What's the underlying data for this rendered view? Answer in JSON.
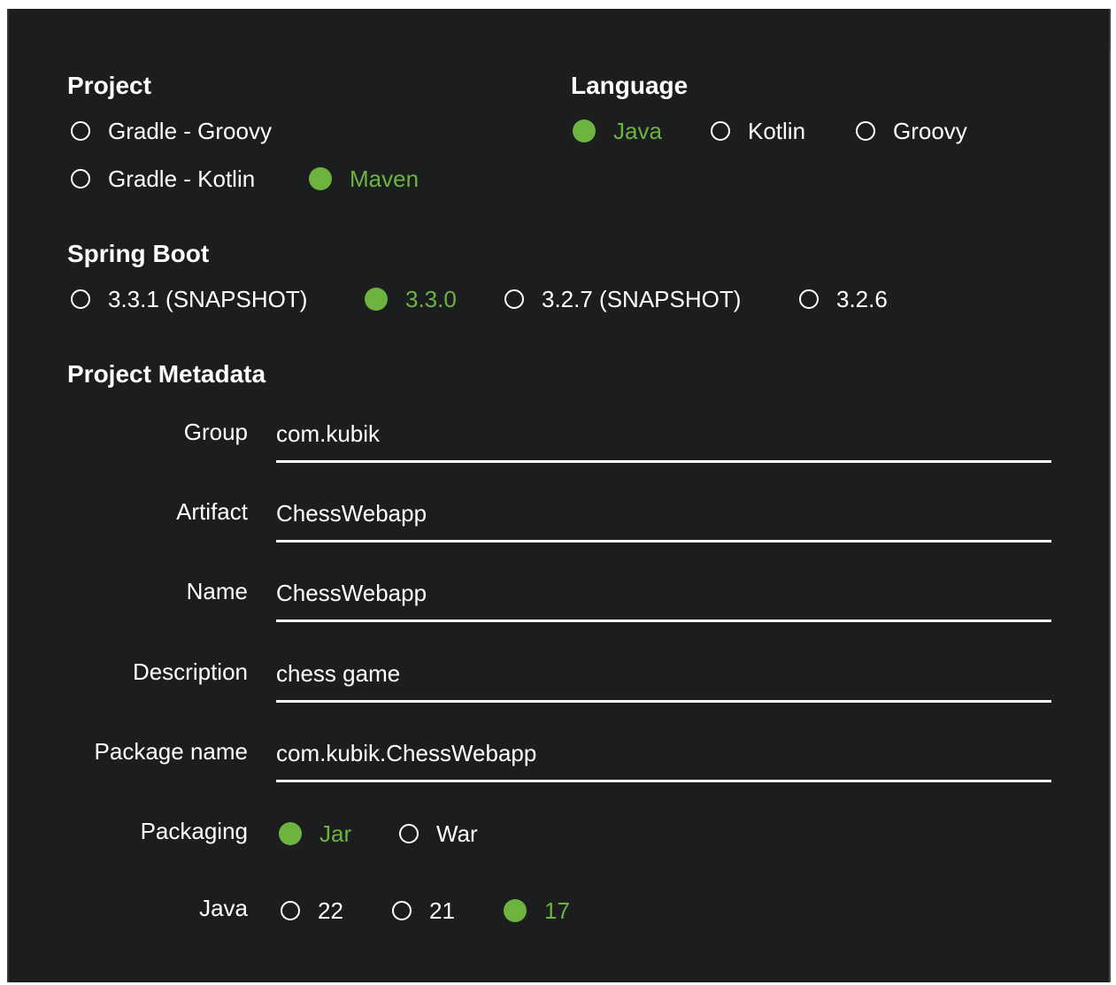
{
  "project": {
    "title": "Project",
    "options": [
      {
        "label": "Gradle - Groovy",
        "selected": false
      },
      {
        "label": "Gradle - Kotlin",
        "selected": false
      },
      {
        "label": "Maven",
        "selected": true
      }
    ]
  },
  "language": {
    "title": "Language",
    "options": [
      {
        "label": "Java",
        "selected": true
      },
      {
        "label": "Kotlin",
        "selected": false
      },
      {
        "label": "Groovy",
        "selected": false
      }
    ]
  },
  "spring_boot": {
    "title": "Spring Boot",
    "options": [
      {
        "label": "3.3.1 (SNAPSHOT)",
        "selected": false
      },
      {
        "label": "3.3.0",
        "selected": true
      },
      {
        "label": "3.2.7 (SNAPSHOT)",
        "selected": false
      },
      {
        "label": "3.2.6",
        "selected": false
      }
    ]
  },
  "metadata": {
    "title": "Project Metadata",
    "group": {
      "label": "Group",
      "value": "com.kubik"
    },
    "artifact": {
      "label": "Artifact",
      "value": "ChessWebapp"
    },
    "name": {
      "label": "Name",
      "value": "ChessWebapp"
    },
    "description": {
      "label": "Description",
      "value": "chess game"
    },
    "package_name": {
      "label": "Package name",
      "value": "com.kubik.ChessWebapp"
    },
    "packaging": {
      "label": "Packaging",
      "options": [
        {
          "label": "Jar",
          "selected": true
        },
        {
          "label": "War",
          "selected": false
        }
      ]
    },
    "java": {
      "label": "Java",
      "options": [
        {
          "label": "22",
          "selected": false
        },
        {
          "label": "21",
          "selected": false
        },
        {
          "label": "17",
          "selected": true
        }
      ]
    }
  },
  "colors": {
    "background": "#1c1d1f",
    "accent": "#6db33f",
    "text": "#ffffff"
  }
}
